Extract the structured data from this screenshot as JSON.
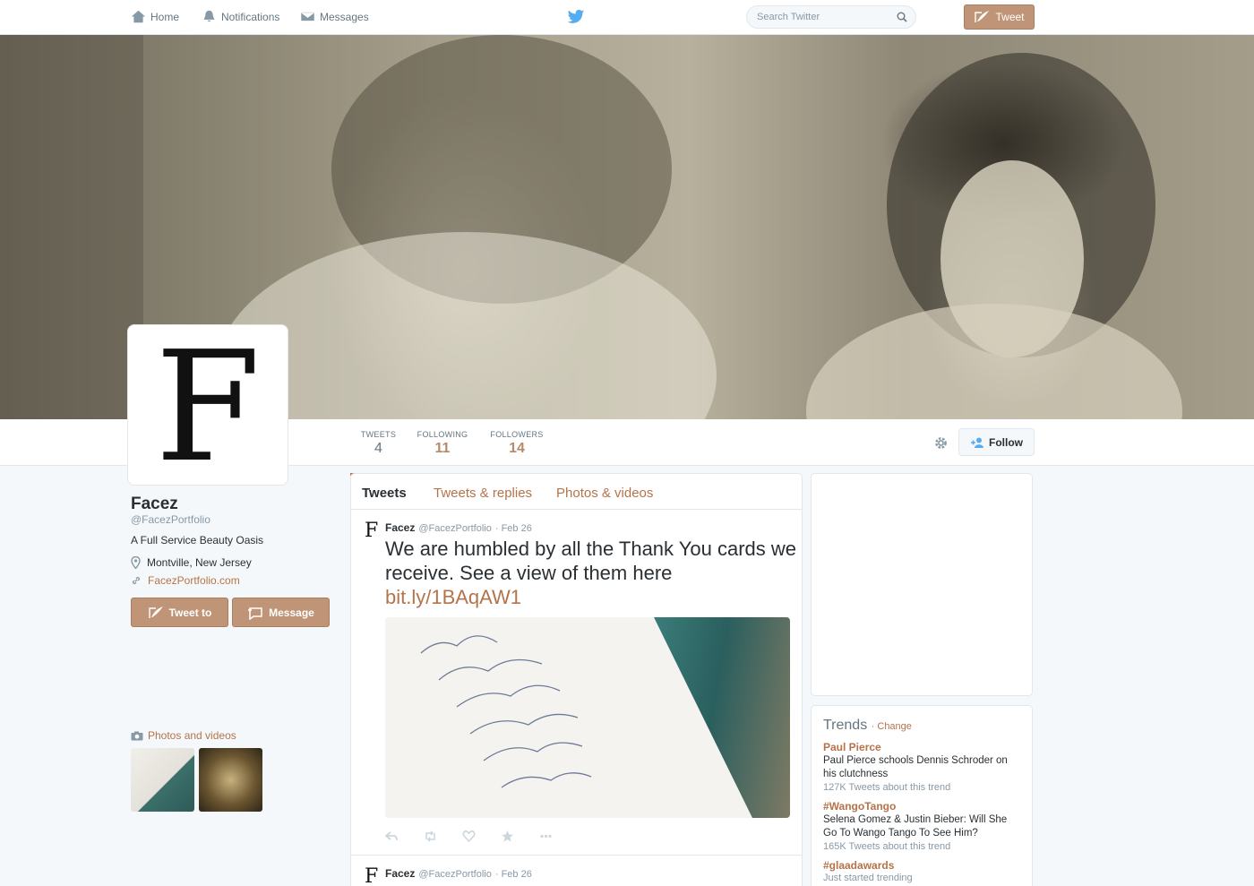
{
  "nav": {
    "home": "Home",
    "notifications": "Notifications",
    "messages": "Messages",
    "search_placeholder": "Search Twitter",
    "tweet_button": "Tweet"
  },
  "profile": {
    "avatar_letter": "F",
    "name": "Facez",
    "handle": "@FacezPortfolio",
    "bio": "A Full Service Beauty Oasis",
    "location": "Montville, New Jersey",
    "url": "FacezPortfolio.com",
    "tweet_to_label": "Tweet to",
    "message_label": "Message",
    "photos_videos_label": "Photos and videos"
  },
  "stats": {
    "tweets_label": "TWEETS",
    "tweets_value": "4",
    "following_label": "FOLLOWING",
    "following_value": "11",
    "followers_label": "FOLLOWERS",
    "followers_value": "14",
    "follow_button": "Follow"
  },
  "timeline": {
    "tabs": [
      "Tweets",
      "Tweets & replies",
      "Photos & videos"
    ],
    "tweets": [
      {
        "name": "Facez",
        "handle": "@FacezPortfolio",
        "date": "· Feb 26",
        "text": "We are humbled by all the Thank You cards we receive.  See a view of them here",
        "link": "bit.ly/1BAqAW1"
      },
      {
        "name": "Facez",
        "handle": "@FacezPortfolio",
        "date": "· Feb 26"
      }
    ]
  },
  "trends": {
    "title": "Trends",
    "change": "· Change",
    "items": [
      {
        "name": "Paul Pierce",
        "desc": "Paul Pierce schools Dennis Schroder on his clutchness",
        "meta": "127K Tweets about this trend"
      },
      {
        "name": "#WangoTango",
        "desc": "Selena Gomez & Justin Bieber: Will She Go To Wango Tango To See Him?",
        "meta": "165K Tweets about this trend"
      },
      {
        "name": "#glaadawards",
        "desc": "",
        "meta": "Just started trending"
      }
    ]
  },
  "colors": {
    "accent": "#b5734a",
    "button": "#c09476",
    "background": "#f5f8fa"
  }
}
